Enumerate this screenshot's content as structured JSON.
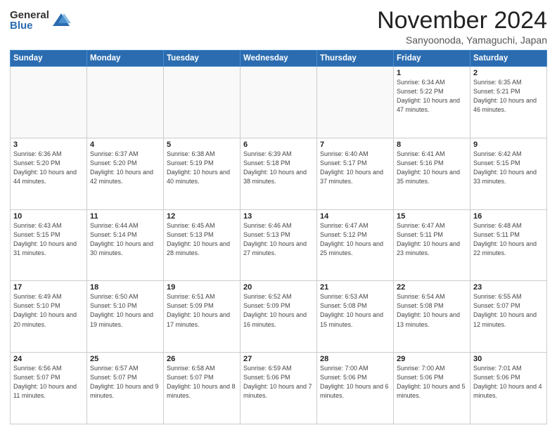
{
  "logo": {
    "general": "General",
    "blue": "Blue"
  },
  "header": {
    "month": "November 2024",
    "location": "Sanyoonoda, Yamaguchi, Japan"
  },
  "weekdays": [
    "Sunday",
    "Monday",
    "Tuesday",
    "Wednesday",
    "Thursday",
    "Friday",
    "Saturday"
  ],
  "weeks": [
    [
      {
        "day": "",
        "info": ""
      },
      {
        "day": "",
        "info": ""
      },
      {
        "day": "",
        "info": ""
      },
      {
        "day": "",
        "info": ""
      },
      {
        "day": "",
        "info": ""
      },
      {
        "day": "1",
        "info": "Sunrise: 6:34 AM\nSunset: 5:22 PM\nDaylight: 10 hours and 47 minutes."
      },
      {
        "day": "2",
        "info": "Sunrise: 6:35 AM\nSunset: 5:21 PM\nDaylight: 10 hours and 46 minutes."
      }
    ],
    [
      {
        "day": "3",
        "info": "Sunrise: 6:36 AM\nSunset: 5:20 PM\nDaylight: 10 hours and 44 minutes."
      },
      {
        "day": "4",
        "info": "Sunrise: 6:37 AM\nSunset: 5:20 PM\nDaylight: 10 hours and 42 minutes."
      },
      {
        "day": "5",
        "info": "Sunrise: 6:38 AM\nSunset: 5:19 PM\nDaylight: 10 hours and 40 minutes."
      },
      {
        "day": "6",
        "info": "Sunrise: 6:39 AM\nSunset: 5:18 PM\nDaylight: 10 hours and 38 minutes."
      },
      {
        "day": "7",
        "info": "Sunrise: 6:40 AM\nSunset: 5:17 PM\nDaylight: 10 hours and 37 minutes."
      },
      {
        "day": "8",
        "info": "Sunrise: 6:41 AM\nSunset: 5:16 PM\nDaylight: 10 hours and 35 minutes."
      },
      {
        "day": "9",
        "info": "Sunrise: 6:42 AM\nSunset: 5:15 PM\nDaylight: 10 hours and 33 minutes."
      }
    ],
    [
      {
        "day": "10",
        "info": "Sunrise: 6:43 AM\nSunset: 5:15 PM\nDaylight: 10 hours and 31 minutes."
      },
      {
        "day": "11",
        "info": "Sunrise: 6:44 AM\nSunset: 5:14 PM\nDaylight: 10 hours and 30 minutes."
      },
      {
        "day": "12",
        "info": "Sunrise: 6:45 AM\nSunset: 5:13 PM\nDaylight: 10 hours and 28 minutes."
      },
      {
        "day": "13",
        "info": "Sunrise: 6:46 AM\nSunset: 5:13 PM\nDaylight: 10 hours and 27 minutes."
      },
      {
        "day": "14",
        "info": "Sunrise: 6:47 AM\nSunset: 5:12 PM\nDaylight: 10 hours and 25 minutes."
      },
      {
        "day": "15",
        "info": "Sunrise: 6:47 AM\nSunset: 5:11 PM\nDaylight: 10 hours and 23 minutes."
      },
      {
        "day": "16",
        "info": "Sunrise: 6:48 AM\nSunset: 5:11 PM\nDaylight: 10 hours and 22 minutes."
      }
    ],
    [
      {
        "day": "17",
        "info": "Sunrise: 6:49 AM\nSunset: 5:10 PM\nDaylight: 10 hours and 20 minutes."
      },
      {
        "day": "18",
        "info": "Sunrise: 6:50 AM\nSunset: 5:10 PM\nDaylight: 10 hours and 19 minutes."
      },
      {
        "day": "19",
        "info": "Sunrise: 6:51 AM\nSunset: 5:09 PM\nDaylight: 10 hours and 17 minutes."
      },
      {
        "day": "20",
        "info": "Sunrise: 6:52 AM\nSunset: 5:09 PM\nDaylight: 10 hours and 16 minutes."
      },
      {
        "day": "21",
        "info": "Sunrise: 6:53 AM\nSunset: 5:08 PM\nDaylight: 10 hours and 15 minutes."
      },
      {
        "day": "22",
        "info": "Sunrise: 6:54 AM\nSunset: 5:08 PM\nDaylight: 10 hours and 13 minutes."
      },
      {
        "day": "23",
        "info": "Sunrise: 6:55 AM\nSunset: 5:07 PM\nDaylight: 10 hours and 12 minutes."
      }
    ],
    [
      {
        "day": "24",
        "info": "Sunrise: 6:56 AM\nSunset: 5:07 PM\nDaylight: 10 hours and 11 minutes."
      },
      {
        "day": "25",
        "info": "Sunrise: 6:57 AM\nSunset: 5:07 PM\nDaylight: 10 hours and 9 minutes."
      },
      {
        "day": "26",
        "info": "Sunrise: 6:58 AM\nSunset: 5:07 PM\nDaylight: 10 hours and 8 minutes."
      },
      {
        "day": "27",
        "info": "Sunrise: 6:59 AM\nSunset: 5:06 PM\nDaylight: 10 hours and 7 minutes."
      },
      {
        "day": "28",
        "info": "Sunrise: 7:00 AM\nSunset: 5:06 PM\nDaylight: 10 hours and 6 minutes."
      },
      {
        "day": "29",
        "info": "Sunrise: 7:00 AM\nSunset: 5:06 PM\nDaylight: 10 hours and 5 minutes."
      },
      {
        "day": "30",
        "info": "Sunrise: 7:01 AM\nSunset: 5:06 PM\nDaylight: 10 hours and 4 minutes."
      }
    ]
  ]
}
